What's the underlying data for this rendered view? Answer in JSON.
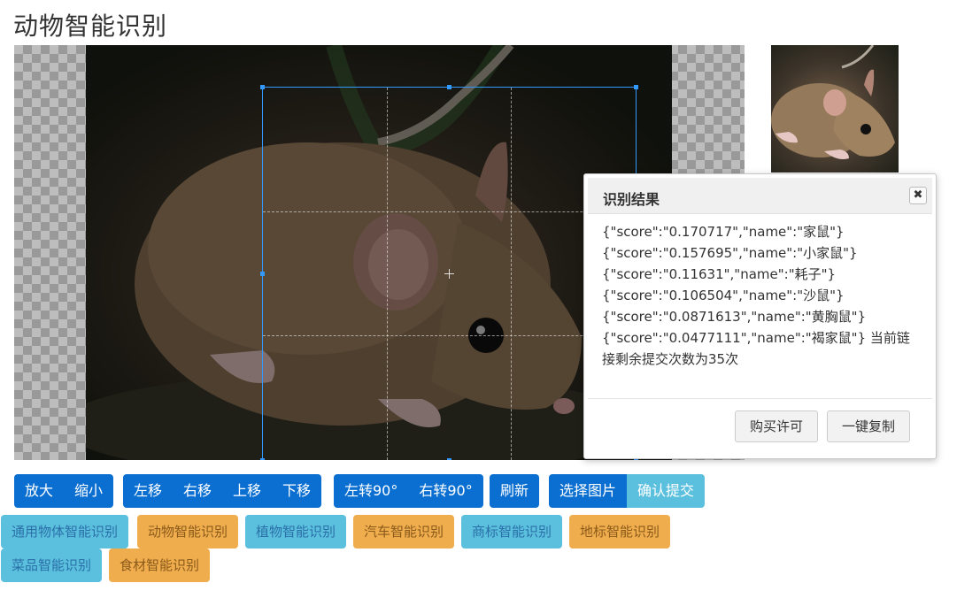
{
  "page": {
    "title": "动物智能识别"
  },
  "toolbar": {
    "zoom_in": "放大",
    "zoom_out": "缩小",
    "move_left": "左移",
    "move_right": "右移",
    "move_up": "上移",
    "move_down": "下移",
    "rotate_left": "左转90°",
    "rotate_right": "右转90°",
    "refresh": "刷新",
    "choose_image": "选择图片",
    "submit": "确认提交"
  },
  "categories": [
    {
      "label": "通用物体智能识别",
      "color": "blue"
    },
    {
      "label": "动物智能识别",
      "color": "orange"
    },
    {
      "label": "植物智能识别",
      "color": "blue"
    },
    {
      "label": "汽车智能识别",
      "color": "orange"
    },
    {
      "label": "商标智能识别",
      "color": "blue"
    },
    {
      "label": "地标智能识别",
      "color": "orange"
    },
    {
      "label": "菜品智能识别",
      "color": "blue"
    },
    {
      "label": "食材智能识别",
      "color": "orange"
    }
  ],
  "result_dialog": {
    "title": "识别结果",
    "close_glyph": "✖",
    "lines": [
      "{\"score\":\"0.170717\",\"name\":\"家鼠\"}",
      "{\"score\":\"0.157695\",\"name\":\"小家鼠\"}",
      "{\"score\":\"0.11631\",\"name\":\"耗子\"}",
      "{\"score\":\"0.106504\",\"name\":\"沙鼠\"}",
      "{\"score\":\"0.0871613\",\"name\":\"黄胸鼠\"}",
      "{\"score\":\"0.0477111\",\"name\":\"褐家鼠\"} 当前链接剩余提交次数为35次"
    ],
    "buy_button": "购买许可",
    "copy_button": "一键复制"
  },
  "colors": {
    "primary": "#0a6fd1",
    "info": "#5bc0de",
    "warning": "#f0ad4e",
    "crop_outline": "#3399ff"
  },
  "icons": {
    "close": "close-icon"
  }
}
